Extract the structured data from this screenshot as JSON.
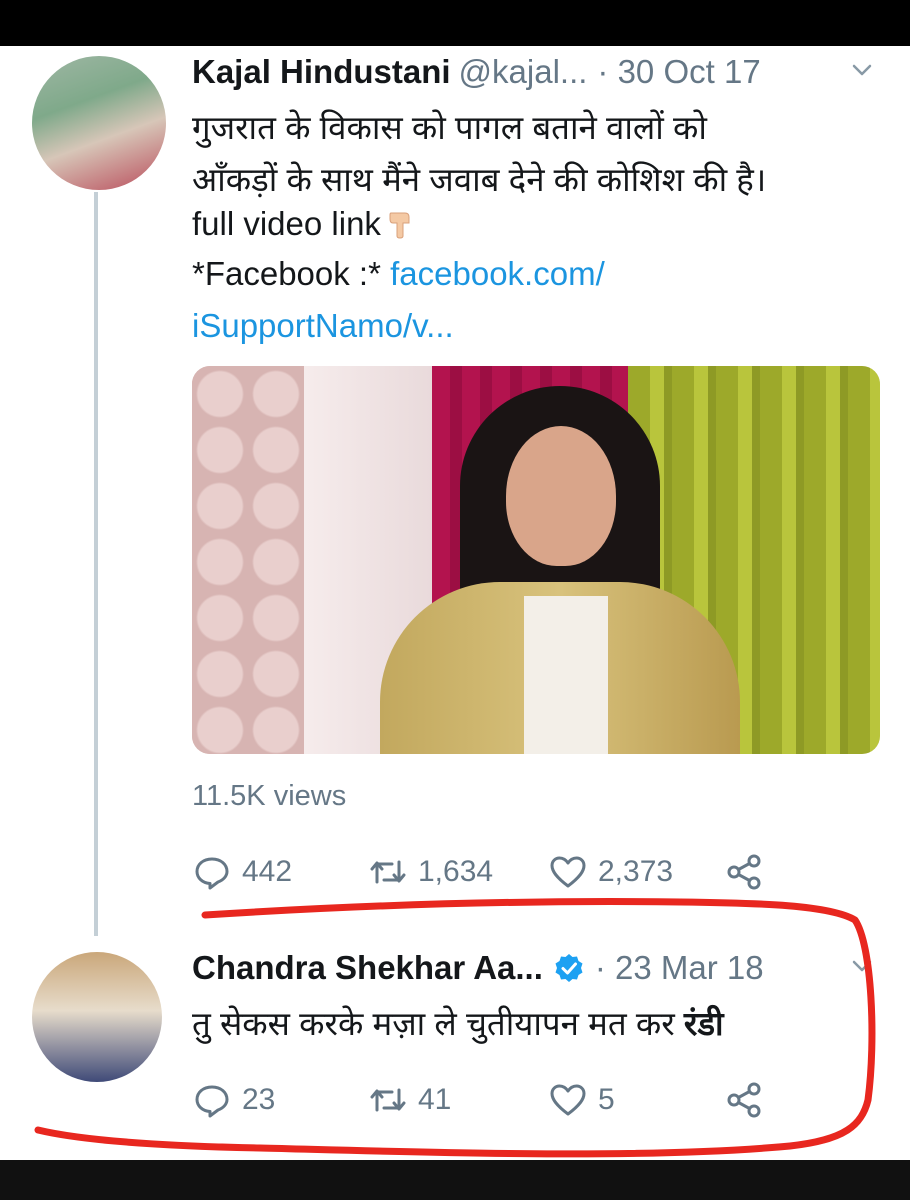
{
  "tweet1": {
    "name": "Kajal Hindustani",
    "handle": "@kajal...",
    "date": "· 30 Oct 17",
    "line1": "गुजरात के विकास को पागल बताने वालों को",
    "line2": "आँकड़ों के साथ मैंने जवाब देने की कोशिश की है।",
    "line3": "full video link",
    "line4_prefix": "*Facebook :* ",
    "link_a": "facebook.com/",
    "link_b": "iSupportNamo/v...",
    "views": "11.5K views",
    "replies": "442",
    "retweets": "1,634",
    "likes": "2,373"
  },
  "tweet2": {
    "name": "Chandra Shekhar Aa...",
    "date": "· 23 Mar 18",
    "text_main": "तु सेकस करके मज़ा ले चुतीयापन मत कर ",
    "text_bold": "रंडी",
    "replies": "23",
    "retweets": "41",
    "likes": "5"
  },
  "icons": {
    "reply": "reply-icon",
    "retweet": "retweet-icon",
    "like": "heart-icon",
    "share": "share-icon",
    "verified": "verified-badge-icon",
    "chevron": "chevron-down-icon",
    "finger": "pointing-down-emoji"
  },
  "colors": {
    "link": "#1b95e0",
    "muted": "#657786",
    "verified": "#1da1f2",
    "annotation": "#e8271f"
  }
}
